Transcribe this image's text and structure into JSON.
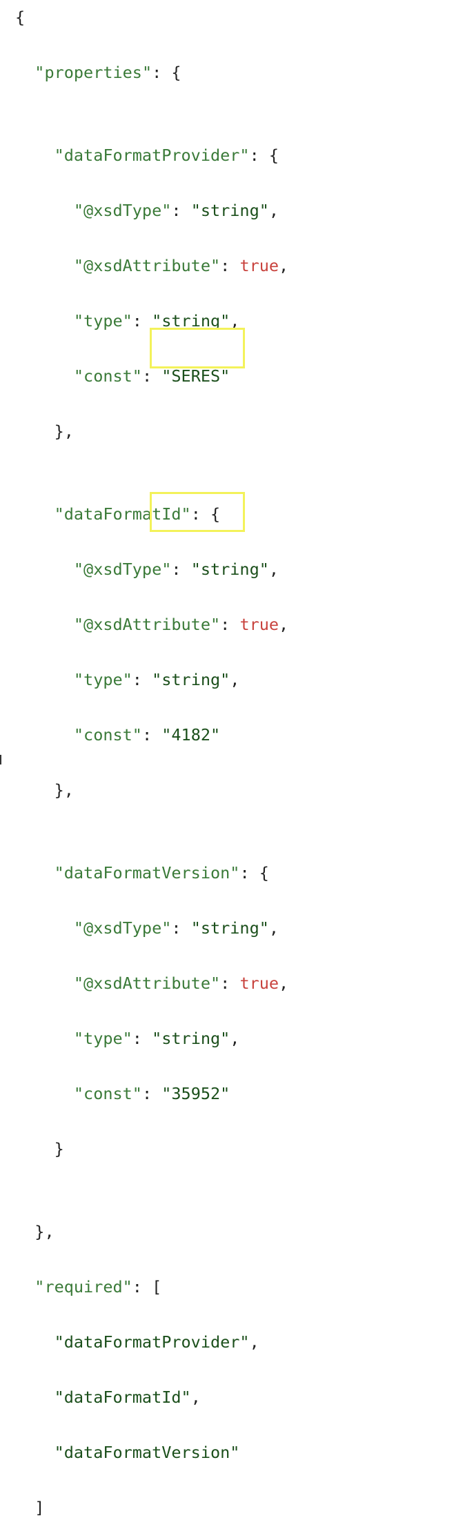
{
  "schema": {
    "properties_key": "properties",
    "required_key": "required",
    "properties": [
      {
        "name": "dataFormatProvider",
        "fields": [
          {
            "key": "@xsdType",
            "value": "string",
            "kind": "string"
          },
          {
            "key": "@xsdAttribute",
            "value": "true",
            "kind": "boolean"
          },
          {
            "key": "type",
            "value": "string",
            "kind": "string"
          },
          {
            "key": "const",
            "value": "SERES",
            "kind": "string"
          }
        ]
      },
      {
        "name": "dataFormatId",
        "fields": [
          {
            "key": "@xsdType",
            "value": "string",
            "kind": "string"
          },
          {
            "key": "@xsdAttribute",
            "value": "true",
            "kind": "boolean"
          },
          {
            "key": "type",
            "value": "string",
            "kind": "string"
          },
          {
            "key": "const",
            "value": "4182",
            "kind": "string"
          }
        ]
      },
      {
        "name": "dataFormatVersion",
        "fields": [
          {
            "key": "@xsdType",
            "value": "string",
            "kind": "string"
          },
          {
            "key": "@xsdAttribute",
            "value": "true",
            "kind": "boolean"
          },
          {
            "key": "type",
            "value": "string",
            "kind": "string"
          },
          {
            "key": "const",
            "value": "35952",
            "kind": "string"
          }
        ]
      }
    ],
    "required": [
      "dataFormatProvider",
      "dataFormatId",
      "dataFormatVersion"
    ]
  },
  "highlight_color": "#f3f25a",
  "colors": {
    "key": "#3a7a38",
    "string": "#1b4f1b",
    "boolean": "#c8423d",
    "punctuation": "#222222"
  }
}
